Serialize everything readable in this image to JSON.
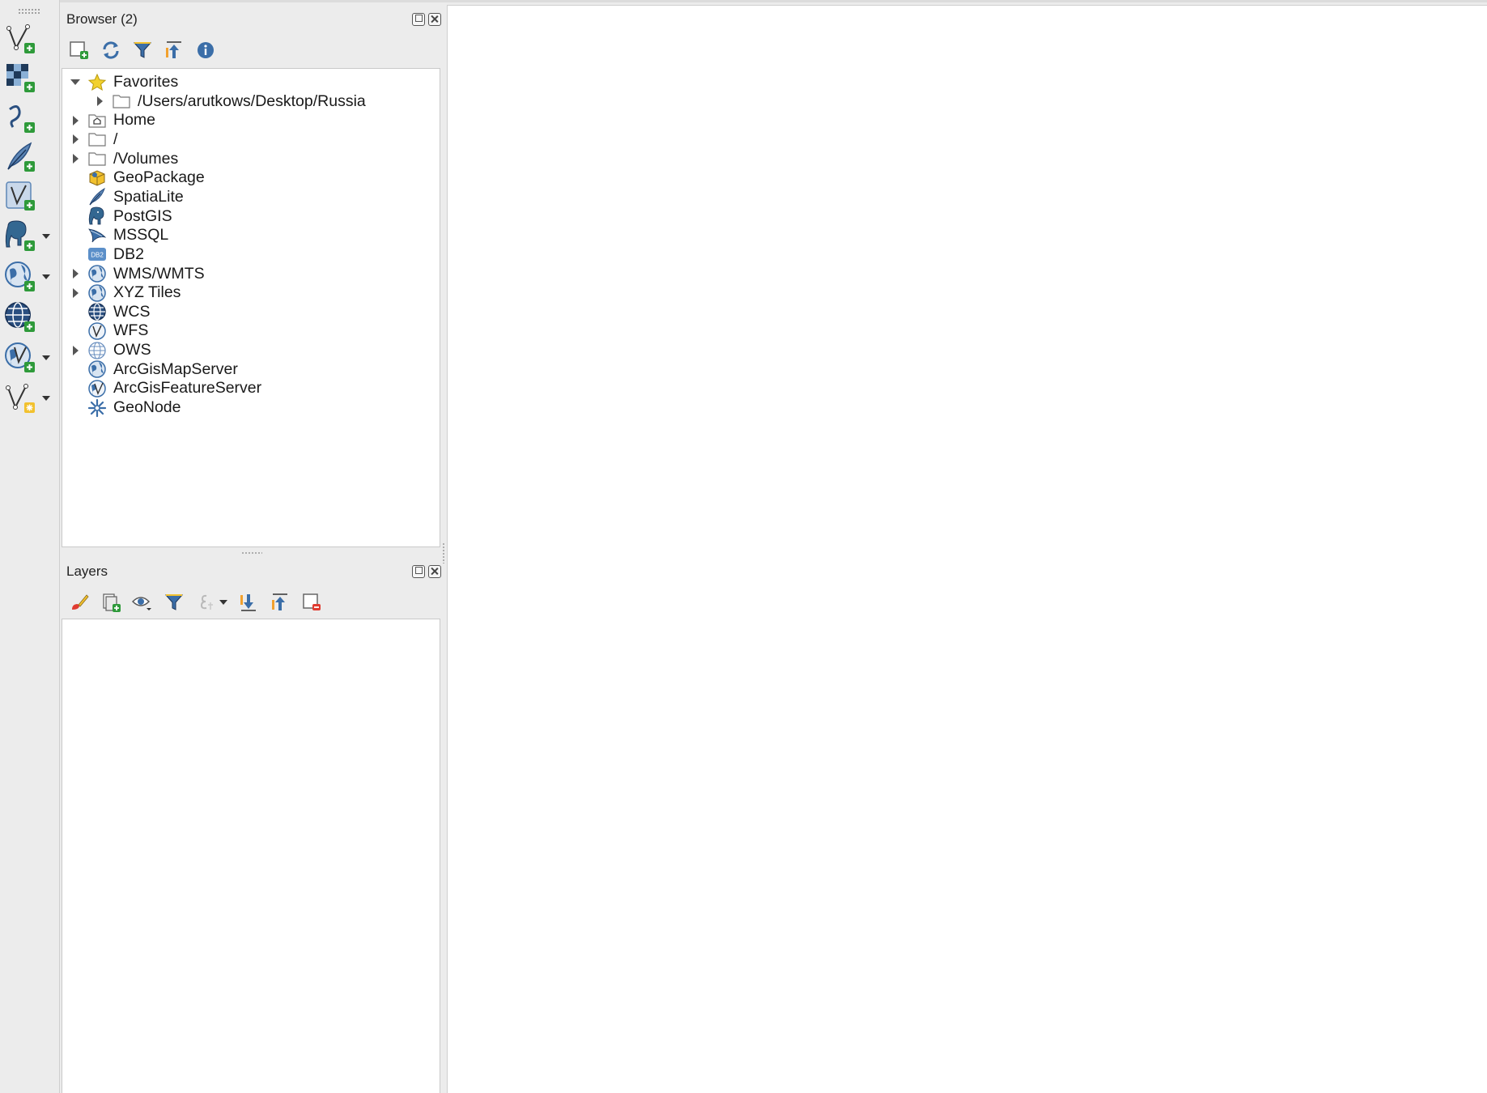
{
  "browser_panel": {
    "title": "Browser (2)",
    "toolbar": [
      "add-selected-layers-icon",
      "refresh-icon",
      "filter-icon",
      "collapse-all-icon",
      "properties-info-icon"
    ],
    "tree": [
      {
        "label": "Favorites",
        "icon": "star-icon",
        "expander": "down",
        "indent": 0
      },
      {
        "label": "/Users/arutkows/Desktop/Russia",
        "icon": "folder-icon",
        "expander": "right",
        "indent": 1
      },
      {
        "label": "Home",
        "icon": "home-folder-icon",
        "expander": "right",
        "indent": 0
      },
      {
        "label": "/",
        "icon": "folder-icon",
        "expander": "right",
        "indent": 0
      },
      {
        "label": "/Volumes",
        "icon": "folder-icon",
        "expander": "right",
        "indent": 0
      },
      {
        "label": "GeoPackage",
        "icon": "geopackage-icon",
        "expander": "none",
        "indent": 0
      },
      {
        "label": "SpatiaLite",
        "icon": "spatialite-feather-icon",
        "expander": "none",
        "indent": 0
      },
      {
        "label": "PostGIS",
        "icon": "postgis-elephant-icon",
        "expander": "none",
        "indent": 0
      },
      {
        "label": "MSSQL",
        "icon": "mssql-icon",
        "expander": "none",
        "indent": 0
      },
      {
        "label": "DB2",
        "icon": "db2-icon",
        "expander": "none",
        "indent": 0
      },
      {
        "label": "WMS/WMTS",
        "icon": "wms-globe-icon",
        "expander": "right",
        "indent": 0
      },
      {
        "label": "XYZ Tiles",
        "icon": "xyz-globe-icon",
        "expander": "right",
        "indent": 0
      },
      {
        "label": "WCS",
        "icon": "wcs-globe-icon",
        "expander": "none",
        "indent": 0
      },
      {
        "label": "WFS",
        "icon": "wfs-globe-icon",
        "expander": "none",
        "indent": 0
      },
      {
        "label": "OWS",
        "icon": "ows-globe-icon",
        "expander": "right",
        "indent": 0
      },
      {
        "label": "ArcGisMapServer",
        "icon": "arcgis-map-globe-icon",
        "expander": "none",
        "indent": 0
      },
      {
        "label": "ArcGisFeatureServer",
        "icon": "arcgis-feature-globe-icon",
        "expander": "none",
        "indent": 0
      },
      {
        "label": "GeoNode",
        "icon": "geonode-icon",
        "expander": "none",
        "indent": 0
      }
    ]
  },
  "layers_panel": {
    "title": "Layers",
    "toolbar": [
      "style-manager-icon",
      "add-group-icon",
      "manage-visibility-icon",
      "filter-legend-icon",
      "filter-expression-icon",
      "expand-all-icon",
      "collapse-all-icon",
      "remove-layer-icon"
    ]
  },
  "left_toolbar": [
    "add-vector-layer-icon",
    "add-raster-layer-icon",
    "add-delimited-text-layer-icon",
    "add-spatialite-layer-icon",
    "add-virtual-layer-icon",
    "add-postgis-layer-icon",
    "add-wms-layer-icon",
    "add-wcs-layer-icon",
    "add-wfs-layer-icon",
    "new-temporary-layer-icon"
  ],
  "colors": {
    "accent_blue": "#3b6ea8",
    "add_green": "#2e9a3a",
    "star_yellow": "#f2d12e"
  }
}
